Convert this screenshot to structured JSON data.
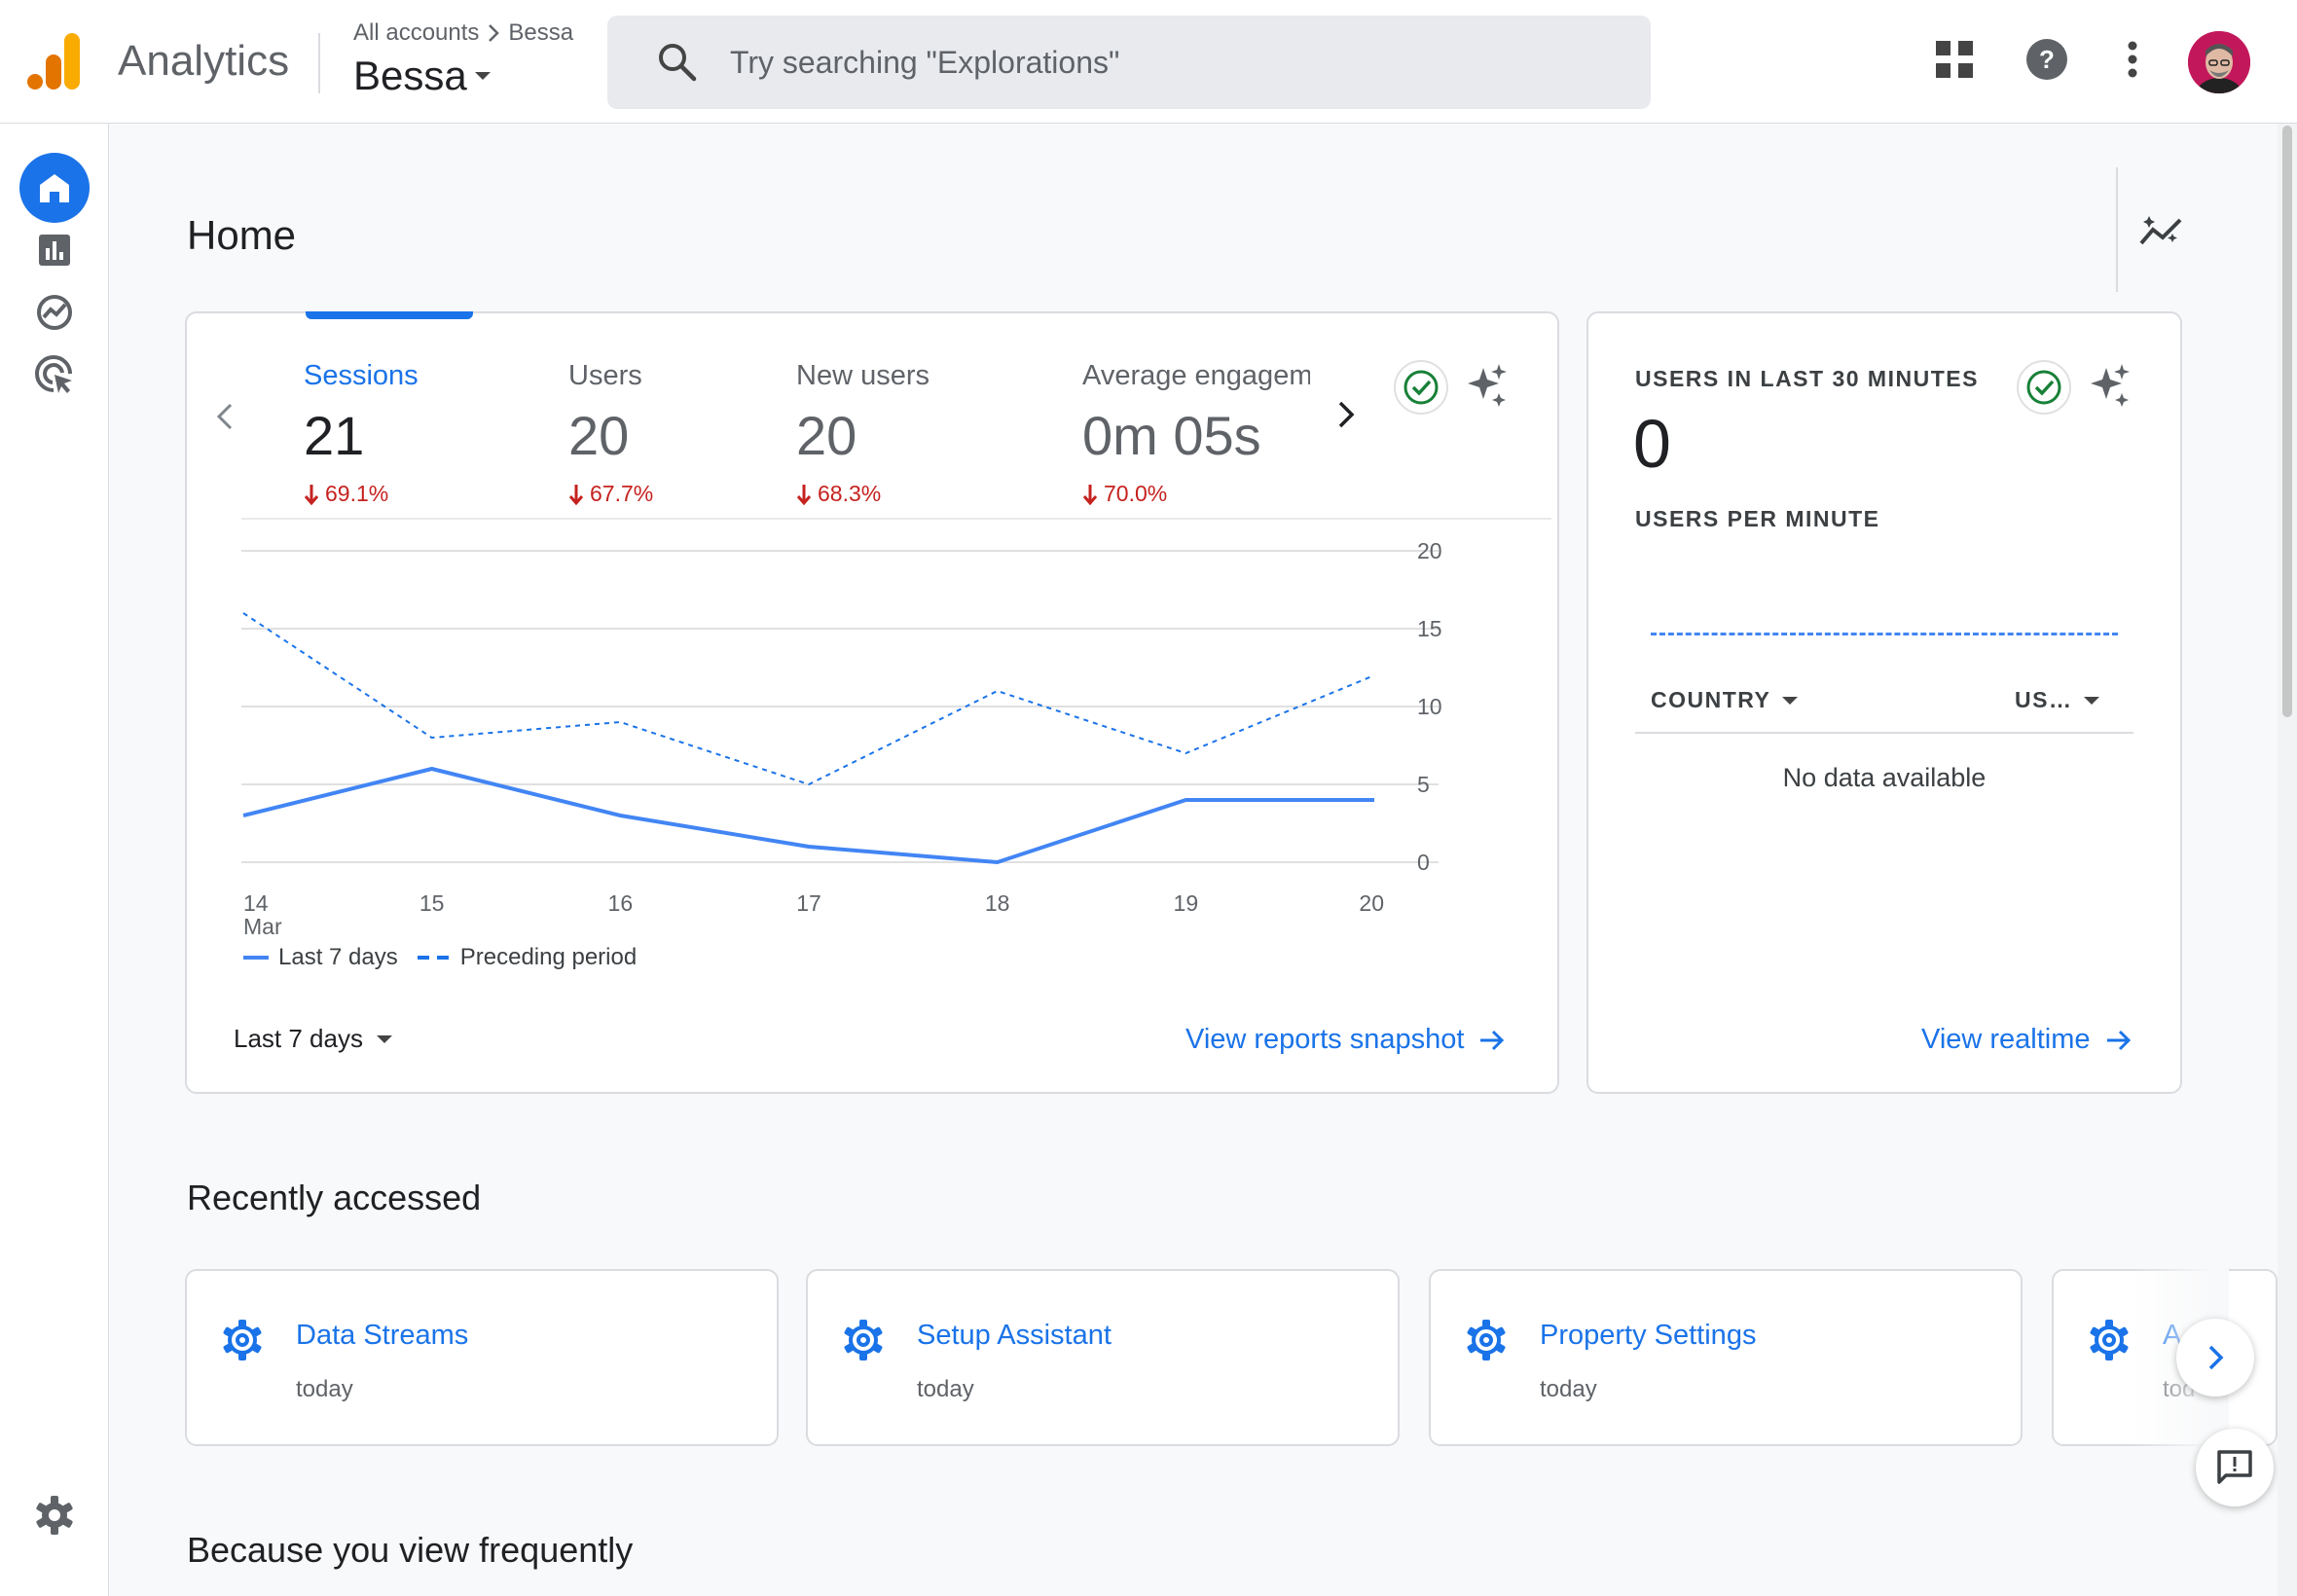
{
  "header": {
    "app_name": "Analytics",
    "breadcrumb": {
      "account": "All accounts",
      "separator": ">",
      "property": "Bessa"
    },
    "property_selector": "Bessa",
    "search": {
      "placeholder": "Try searching \"Explorations\""
    },
    "icons": [
      "apps-grid-icon",
      "help-icon",
      "more-vert-icon",
      "account-avatar"
    ]
  },
  "sidebar": {
    "items": [
      {
        "name": "home",
        "icon": "home-icon",
        "active": true
      },
      {
        "name": "reports",
        "icon": "bar-chart-icon",
        "active": false
      },
      {
        "name": "explore",
        "icon": "explore-icon",
        "active": false
      },
      {
        "name": "advertising",
        "icon": "target-cursor-icon",
        "active": false
      }
    ],
    "settings_icon": "settings-gear-icon"
  },
  "page": {
    "title": "Home"
  },
  "overview_card": {
    "metrics": [
      {
        "label": "Sessions",
        "value": "21",
        "change": "69.1%",
        "direction": "down",
        "active": true
      },
      {
        "label": "Users",
        "value": "20",
        "change": "67.7%",
        "direction": "down",
        "active": false
      },
      {
        "label": "New users",
        "value": "20",
        "change": "68.3%",
        "direction": "down",
        "active": false
      },
      {
        "label": "Average engagem",
        "value": "0m 05s",
        "change": "70.0%",
        "direction": "down",
        "active": false
      }
    ],
    "legend": {
      "current": "Last 7 days",
      "previous": "Preceding period"
    },
    "date_range": "Last 7 days",
    "link": "View reports snapshot"
  },
  "chart_data": {
    "type": "line",
    "x": [
      "14",
      "15",
      "16",
      "17",
      "18",
      "19",
      "20"
    ],
    "x_sublabel": "Mar",
    "y_ticks": [
      "0",
      "5",
      "10",
      "15",
      "20"
    ],
    "ylim": [
      0,
      20
    ],
    "series": [
      {
        "name": "Last 7 days",
        "style": "solid",
        "color": "#4285f4",
        "values": [
          3,
          6,
          3,
          1,
          0,
          4,
          4
        ]
      },
      {
        "name": "Preceding period",
        "style": "dashed",
        "color": "#1a73e8",
        "values": [
          16,
          8,
          9,
          5,
          11,
          7,
          12
        ]
      }
    ],
    "grid": true
  },
  "realtime_card": {
    "title": "USERS IN LAST 30 MINUTES",
    "value": "0",
    "subtitle": "USERS PER MINUTE",
    "columns": [
      "COUNTRY",
      "US…"
    ],
    "empty_text": "No data available",
    "link": "View realtime"
  },
  "recently_accessed": {
    "title": "Recently accessed",
    "items": [
      {
        "name": "Data Streams",
        "time": "today"
      },
      {
        "name": "Setup Assistant",
        "time": "today"
      },
      {
        "name": "Property Settings",
        "time": "today"
      },
      {
        "name": "A",
        "time": "tod"
      }
    ]
  },
  "frequent": {
    "title": "Because you view frequently"
  },
  "colors": {
    "accent": "#1a73e8",
    "negative": "#c5221f",
    "logo_orange": "#f9ab00",
    "logo_dark_orange": "#e37400"
  }
}
